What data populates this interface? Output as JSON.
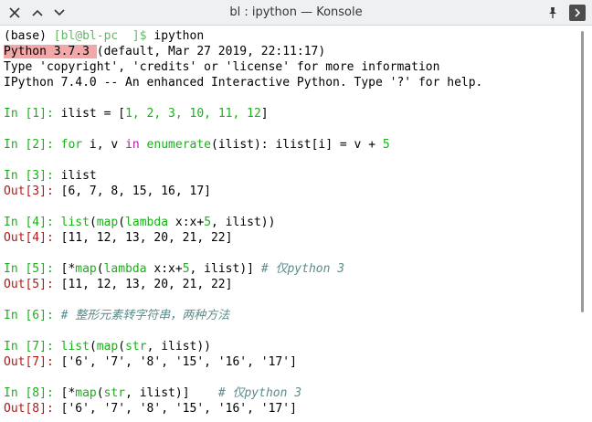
{
  "window": {
    "title": "bl : ipython — Konsole"
  },
  "terminal": {
    "prompt_env": "(base)",
    "prompt_userhost": "[bl@bl-pc  ]$",
    "prompt_cmd": " ipython",
    "py_version": "Python 3.7.3 ",
    "py_build": "(default, Mar 27 2019, 22:11:17)",
    "info_line": "Type 'copyright', 'credits' or 'license' for more information",
    "ipython_line": "IPython 7.4.0 -- An enhanced Interactive Python. Type '?' for help.",
    "in1_prompt": "In [1]:",
    "in1_code_a": " ilist = [",
    "in1_nums": "1, 2, 3, 10, 11, 12",
    "in1_code_b": "]",
    "in2_prompt": "In [2]:",
    "in2_for": " for",
    "in2_i_v": " i, v ",
    "in2_in": "in",
    "in2_enumerate": " enumerate",
    "in2_rest": "(ilist): ilist[i] = v + ",
    "in2_five": "5",
    "in3_prompt": "In [3]:",
    "in3_code": " ilist",
    "out3_prompt": "Out[3]:",
    "out3_value": " [6, 7, 8, 15, 16, 17]",
    "in4_prompt": "In [4]:",
    "in4_list": " list",
    "in4_paren": "(",
    "in4_map": "map",
    "in4_paren2": "(",
    "in4_lambda": "lambda",
    "in4_x": " x:x+",
    "in4_five": "5",
    "in4_rest": ", ilist))",
    "out4_prompt": "Out[4]:",
    "out4_value": " [11, 12, 13, 20, 21, 22]",
    "in5_prompt": "In [5]:",
    "in5_star": " [*",
    "in5_map": "map",
    "in5_paren": "(",
    "in5_lambda": "lambda",
    "in5_x": " x:x+",
    "in5_five": "5",
    "in5_rest": ", ilist)] ",
    "in5_comment": "# 仅python 3",
    "out5_prompt": "Out[5]:",
    "out5_value": " [11, 12, 13, 20, 21, 22]",
    "in6_prompt": "In [6]:",
    "in6_comment": " # 整形元素转字符串，两种方法",
    "in7_prompt": "In [7]:",
    "in7_list": " list",
    "in7_paren": "(",
    "in7_map": "map",
    "in7_paren2": "(",
    "in7_str": "str",
    "in7_rest": ", ilist))",
    "out7_prompt": "Out[7]:",
    "out7_value": " ['6', '7', '8', '15', '16', '17']",
    "in8_prompt": "In [8]:",
    "in8_star": " [*",
    "in8_map": "map",
    "in8_paren": "(",
    "in8_str": "str",
    "in8_rest": ", ilist)]    ",
    "in8_comment": "# 仅python 3",
    "out8_prompt": "Out[8]:",
    "out8_value": " ['6', '7', '8', '15', '16', '17']"
  },
  "icons": {
    "close": "close-icon",
    "up": "chevron-up-icon",
    "down": "chevron-down-icon",
    "pin": "pin-icon",
    "menu": "menu-icon"
  },
  "colors": {
    "prompt_in": "#18b218",
    "prompt_out": "#b21818",
    "keyword": "#b218b2",
    "comment": "#5a8c8c",
    "highlight": "#f2a8a8"
  }
}
